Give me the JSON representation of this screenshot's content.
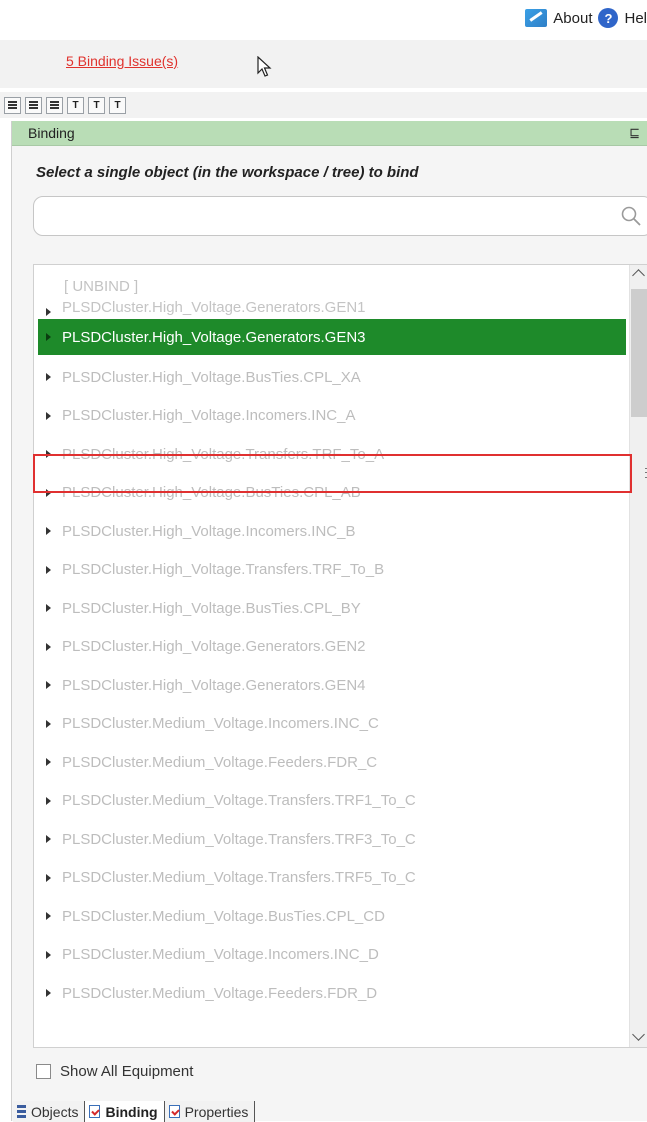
{
  "top_links": {
    "about": "About",
    "help": "Hel"
  },
  "issues_link": "5 Binding Issue(s)",
  "panel": {
    "title": "Binding",
    "pin": "⊑",
    "instruction": "Select a single object (in the workspace / tree) to bind"
  },
  "search": {
    "value": "",
    "placeholder": ""
  },
  "list": {
    "unbind": "[ UNBIND ]",
    "partial_item": "PLSDCluster.High_Voltage.Generators.GEN1",
    "selected_item": "PLSDCluster.High_Voltage.Generators.GEN3",
    "items": [
      "PLSDCluster.High_Voltage.BusTies.CPL_XA",
      "PLSDCluster.High_Voltage.Incomers.INC_A",
      "PLSDCluster.High_Voltage.Transfers.TRF_To_A",
      "PLSDCluster.High_Voltage.BusTies.CPL_AB",
      "PLSDCluster.High_Voltage.Incomers.INC_B",
      "PLSDCluster.High_Voltage.Transfers.TRF_To_B",
      "PLSDCluster.High_Voltage.BusTies.CPL_BY",
      "PLSDCluster.High_Voltage.Generators.GEN2",
      "PLSDCluster.High_Voltage.Generators.GEN4",
      "PLSDCluster.Medium_Voltage.Incomers.INC_C",
      "PLSDCluster.Medium_Voltage.Feeders.FDR_C",
      "PLSDCluster.Medium_Voltage.Transfers.TRF1_To_C",
      "PLSDCluster.Medium_Voltage.Transfers.TRF3_To_C",
      "PLSDCluster.Medium_Voltage.Transfers.TRF5_To_C",
      "PLSDCluster.Medium_Voltage.BusTies.CPL_CD",
      "PLSDCluster.Medium_Voltage.Incomers.INC_D",
      "PLSDCluster.Medium_Voltage.Feeders.FDR_D"
    ]
  },
  "show_all": {
    "label": "Show All Equipment",
    "checked": false
  },
  "tabs": {
    "objects": "Objects",
    "binding": "Binding",
    "properties": "Properties"
  },
  "colors": {
    "selected_bg": "#1e8a2a",
    "header_bg": "#b9ddb6",
    "issues_link": "#e0322d",
    "highlight_border": "#e03030"
  },
  "icons": [
    "about-icon",
    "help-icon",
    "search-icon",
    "pin-icon",
    "chevron-up-icon",
    "chevron-down-icon",
    "expand-arrow-icon",
    "objects-icon",
    "binding-doc-icon",
    "properties-doc-icon"
  ]
}
